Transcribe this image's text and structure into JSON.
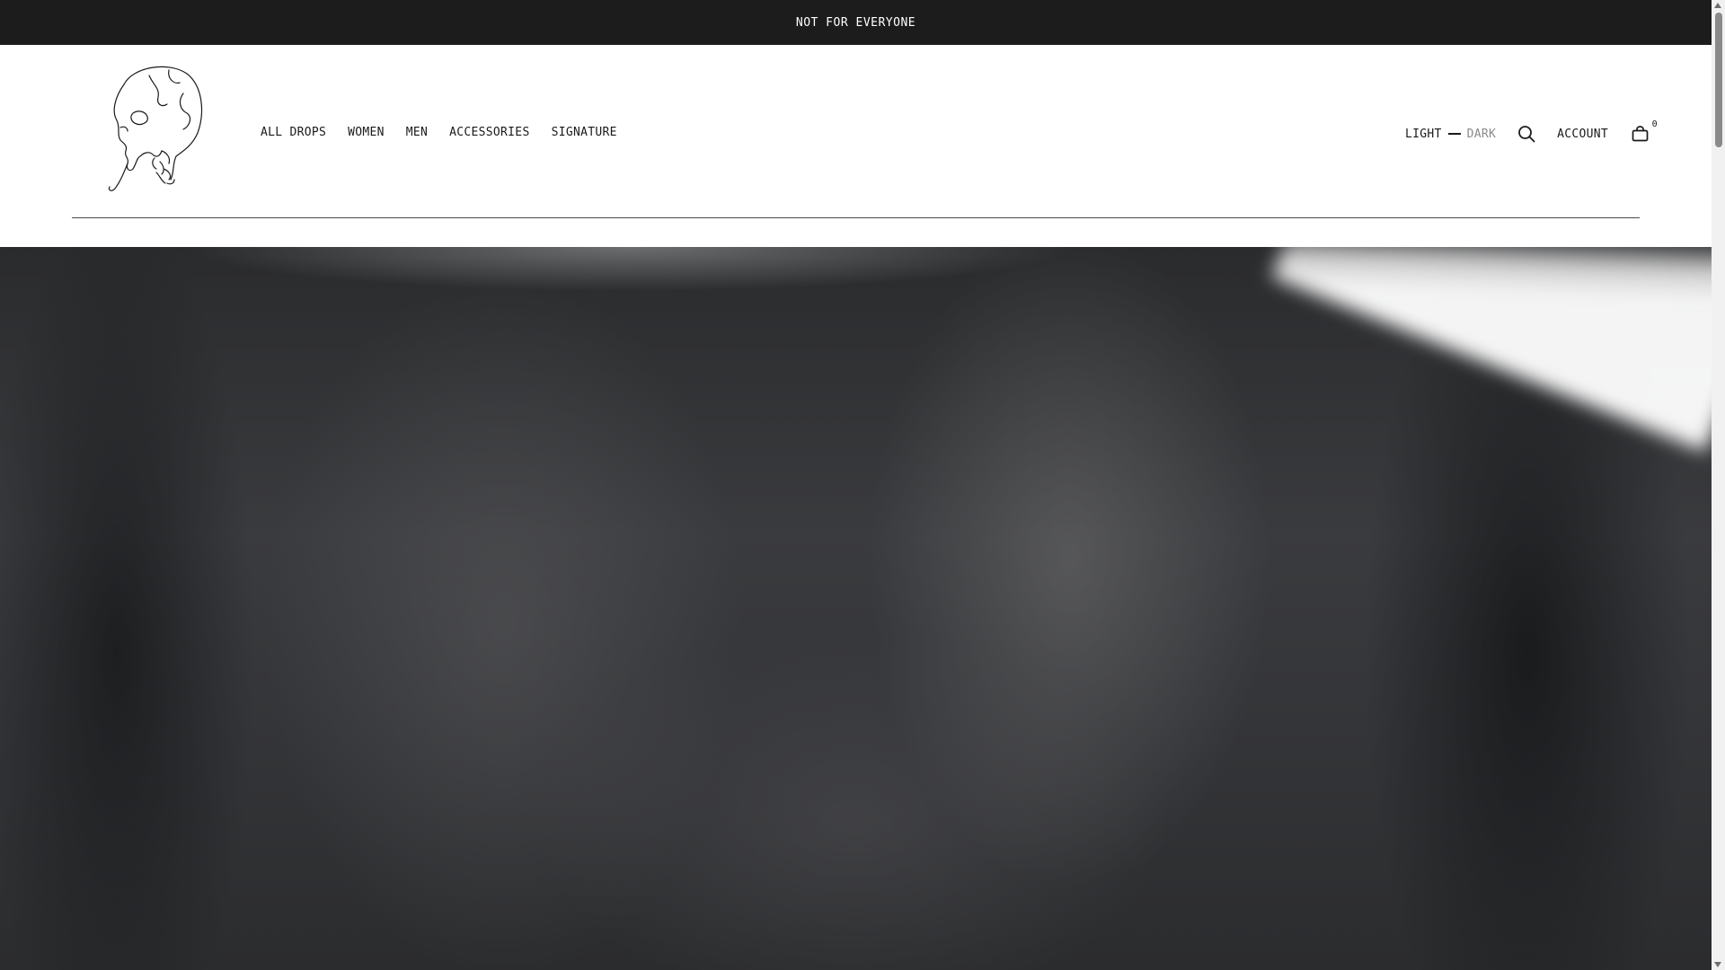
{
  "announcement": {
    "text": "NOT FOR EVERYONE"
  },
  "header": {
    "logo_icon": "skull-logo-icon",
    "nav": [
      {
        "label": "ALL DROPS"
      },
      {
        "label": "WOMEN"
      },
      {
        "label": "MEN"
      },
      {
        "label": "ACCESSORIES"
      },
      {
        "label": "SIGNATURE"
      }
    ],
    "theme_toggle": {
      "light_label": "LIGHT",
      "dark_label": "DARK",
      "active": "light"
    },
    "search_icon": "search-icon",
    "account_label": "ACCOUNT",
    "cart": {
      "icon": "bag-icon",
      "count": "0"
    }
  },
  "hero": {
    "image": "blurred-dark-photo"
  },
  "colors": {
    "announcement_bg": "#1c1c1c",
    "text": "#1a1a1a",
    "inactive_text": "#8a8a8a",
    "hero_base": "#333437"
  }
}
